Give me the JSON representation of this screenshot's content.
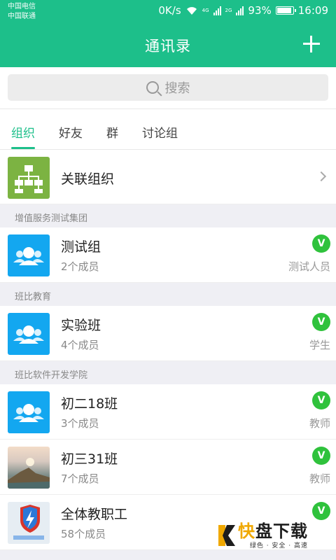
{
  "status_bar": {
    "carrier_1": "中国电信",
    "carrier_2": "中国联通",
    "net_speed": "0K/s",
    "net_4g": "4G",
    "net_2g": "2G",
    "battery": "93%",
    "time": "16:09"
  },
  "header": {
    "title": "通讯录",
    "add_icon": "plus-icon"
  },
  "search": {
    "placeholder": "搜索",
    "icon": "search-icon"
  },
  "tabs": [
    {
      "label": "组织",
      "active": true
    },
    {
      "label": "好友",
      "active": false
    },
    {
      "label": "群",
      "active": false
    },
    {
      "label": "讨论组",
      "active": false
    }
  ],
  "linked_org": {
    "label": "关联组织",
    "icon": "org-chart-icon"
  },
  "sections": [
    {
      "title": "增值服务测试集团",
      "groups": [
        {
          "name": "测试组",
          "members": "2个成员",
          "role": "测试人员",
          "badge": "V",
          "avatar": "group-icon"
        }
      ]
    },
    {
      "title": "班比教育",
      "groups": [
        {
          "name": "实验班",
          "members": "4个成员",
          "role": "学生",
          "badge": "V",
          "avatar": "group-icon"
        }
      ]
    },
    {
      "title": "班比软件开发学院",
      "groups": [
        {
          "name": "初二18班",
          "members": "3个成员",
          "role": "教师",
          "badge": "V",
          "avatar": "group-icon"
        },
        {
          "name": "初三31班",
          "members": "7个成员",
          "role": "教师",
          "badge": "V",
          "avatar": "landscape-photo"
        },
        {
          "name": "全体教职工",
          "members": "58个成员",
          "role": "",
          "badge": "V",
          "avatar": "shield-photo"
        }
      ]
    }
  ],
  "watermark": {
    "brand_1": "快",
    "brand_2": "盘下载",
    "slogan": "绿色 · 安全 · 高速"
  },
  "colors": {
    "primary": "#1dbf8a",
    "badge": "#2fc23c",
    "group_avatar": "#13a7f0",
    "org_avatar": "#7cb342"
  }
}
